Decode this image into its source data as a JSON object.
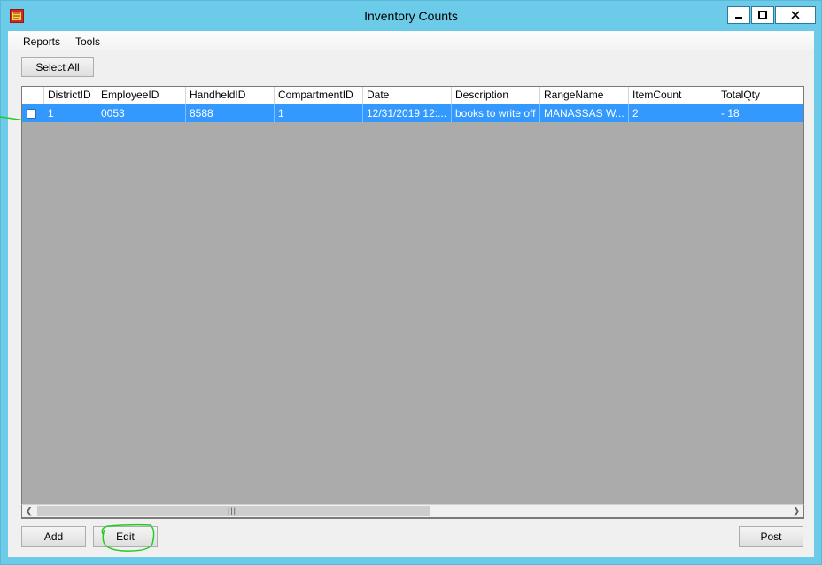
{
  "window": {
    "title": "Inventory Counts"
  },
  "menu": {
    "items": [
      "Reports",
      "Tools"
    ]
  },
  "toolbar": {
    "select_all_label": "Select All"
  },
  "grid": {
    "columns": [
      "DistrictID",
      "EmployeeID",
      "HandheldID",
      "CompartmentID",
      "Date",
      "Description",
      "RangeName",
      "ItemCount",
      "TotalQty"
    ],
    "rows": [
      [
        "1",
        "0053",
        "8588",
        "1",
        "12/31/2019 12:...",
        "books to write off",
        "MANASSAS W...",
        "2",
        "- 18"
      ]
    ]
  },
  "buttons": {
    "add_label": "Add",
    "edit_label": "Edit",
    "post_label": "Post"
  },
  "colors": {
    "title_bar": "#6ccbe8",
    "selection": "#3399ff",
    "grid_background": "#ababab",
    "annotation": "#22cc22"
  }
}
